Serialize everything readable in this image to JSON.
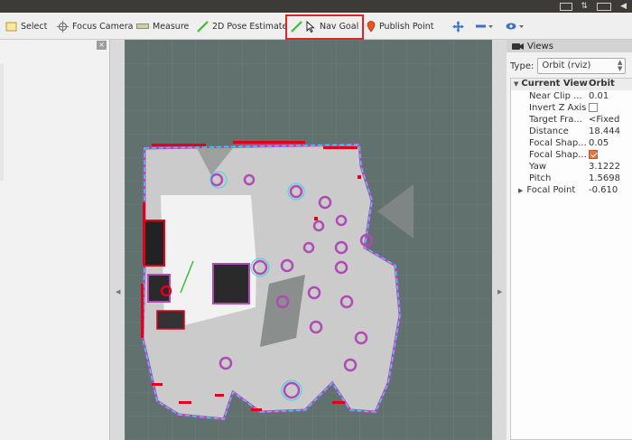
{
  "toolbar": {
    "select_label": "Select",
    "focus_camera_label": "Focus Camera",
    "measure_label": "Measure",
    "pose_estimate_label": "2D Pose Estimate",
    "nav_goal_label": "Nav Goal",
    "publish_point_label": "Publish Point"
  },
  "views_panel": {
    "title": "Views",
    "type_label": "Type:",
    "type_value": "Orbit (rviz)",
    "tree_header_name": "Current View",
    "tree_header_value": "Orbit",
    "properties": [
      {
        "name": "Near Clip ...",
        "value": "0.01"
      },
      {
        "name": "Invert Z Axis",
        "value": ""
      },
      {
        "name": "Target Fra...",
        "value": "<Fixed"
      },
      {
        "name": "Distance",
        "value": "18.444"
      },
      {
        "name": "Focal Shap...",
        "value": "0.05"
      },
      {
        "name": "Focal Shap...",
        "value": ""
      },
      {
        "name": "Yaw",
        "value": "3.1222"
      },
      {
        "name": "Pitch",
        "value": "1.5698"
      },
      {
        "name": "Focal Point",
        "value": "-0.610"
      }
    ]
  },
  "left_panel": {
    "close_label": "×"
  },
  "colors": {
    "highlight": "#e0232b",
    "map_background": "#60716e",
    "free_space": "#c9c9c9",
    "obstacle": "#e3001b",
    "inflation": "#38d6e6",
    "inflation_outer": "#b04ab6"
  },
  "icons": [
    "select-icon",
    "focus-camera-icon",
    "measure-icon",
    "pose-estimate-icon",
    "nav-goal-icon",
    "publish-point-icon",
    "move-camera-icon",
    "minus-icon",
    "eye-icon",
    "views-camera-icon"
  ]
}
